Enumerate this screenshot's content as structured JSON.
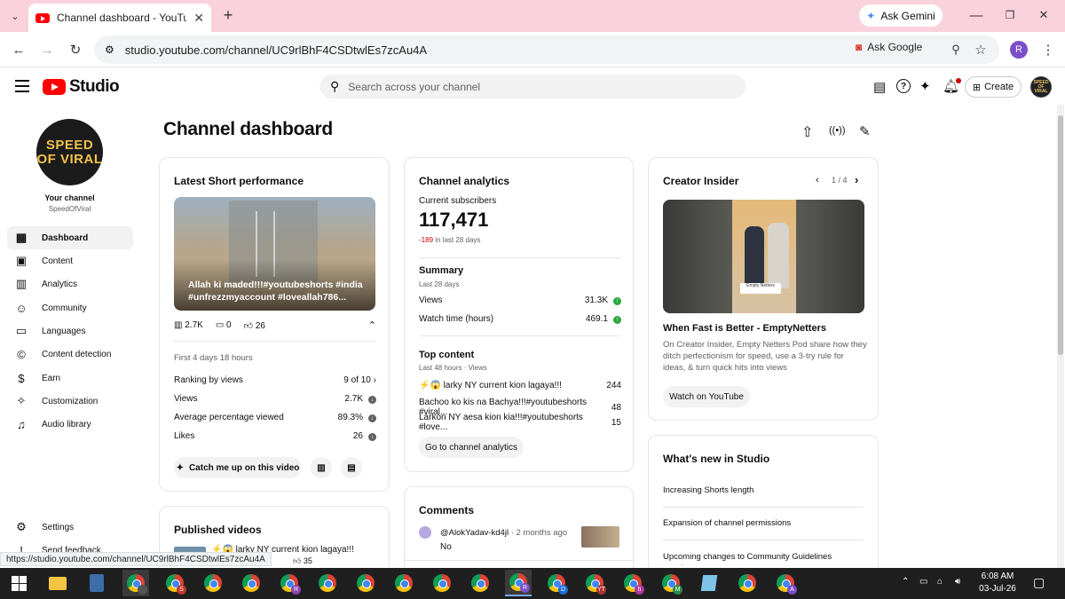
{
  "browser": {
    "tab_title": "Channel dashboard - YouTube Studio",
    "gemini_label": "Ask Gemini",
    "url": "studio.youtube.com/channel/UC9rlBhF4CSDtwlEs7zcAu4A",
    "ask_google_label": "Ask Google",
    "profile_initial": "R"
  },
  "header": {
    "brand": "Studio",
    "search_placeholder": "Search across your channel",
    "create_label": "Create"
  },
  "sidebar": {
    "your_channel": "Your channel",
    "channel_name": "SpeedOfViral",
    "logo_text": "SPEED OF VIRAL",
    "items": [
      {
        "label": "Dashboard",
        "icon": "grid-icon"
      },
      {
        "label": "Content",
        "icon": "content-icon"
      },
      {
        "label": "Analytics",
        "icon": "analytics-icon"
      },
      {
        "label": "Community",
        "icon": "community-icon"
      },
      {
        "label": "Languages",
        "icon": "languages-icon"
      },
      {
        "label": "Content detection",
        "icon": "copyright-icon"
      },
      {
        "label": "Earn",
        "icon": "dollar-icon"
      },
      {
        "label": "Customization",
        "icon": "wand-icon"
      },
      {
        "label": "Audio library",
        "icon": "audio-library-icon"
      }
    ],
    "settings": "Settings",
    "feedback": "Send feedback"
  },
  "main": {
    "title": "Channel dashboard",
    "latest_short": {
      "title": "Latest Short performance",
      "video_caption": "Allah ki maded!!!#youtubeshorts #india #unfrezzmyaccount #loveallah786...",
      "views_count": "2.7K",
      "comments_count": "0",
      "likes_count": "26",
      "period": "First 4 days 18 hours",
      "stats": [
        {
          "label": "Ranking by views",
          "value": "9 of 10"
        },
        {
          "label": "Views",
          "value": "2.7K"
        },
        {
          "label": "Average percentage viewed",
          "value": "89.3%"
        },
        {
          "label": "Likes",
          "value": "26"
        }
      ],
      "catch_up_label": "Catch me up on this video"
    },
    "analytics": {
      "title": "Channel analytics",
      "subs_label": "Current subscribers",
      "subs_value": "117,471",
      "subs_change": "-189",
      "subs_change_period": "in last 28 days",
      "summary_title": "Summary",
      "summary_period": "Last 28 days",
      "summary_rows": [
        {
          "label": "Views",
          "value": "31.3K"
        },
        {
          "label": "Watch time (hours)",
          "value": "469.1"
        }
      ],
      "top_title": "Top content",
      "top_period": "Last 48 hours · Views",
      "top_rows": [
        {
          "label": "⚡😱 larky NY current kion lagaya!!!",
          "value": "244"
        },
        {
          "label": "Bachoo ko kis na Bachya!!!#youtubeshorts #viral...",
          "value": "48"
        },
        {
          "label": "Larkon NY aesa kion kia!!!#youtubeshorts #love...",
          "value": "15"
        }
      ],
      "go_label": "Go to channel analytics"
    },
    "insider": {
      "title": "Creator Insider",
      "pager": "1 / 4",
      "video_badge": "Empty Netters",
      "video_title": "When Fast is Better - EmptyNetters",
      "video_desc": "On Creator Insider, Empty Netters Pod share how they ditch perfectionism for speed, use a 3-try rule for ideas, & turn quick hits into views",
      "watch_label": "Watch on YouTube"
    },
    "whats_new": {
      "title": "What's new in Studio",
      "items": [
        "Increasing Shorts length",
        "Expansion of channel permissions",
        "Upcoming changes to Community Guidelines warnings"
      ]
    },
    "published": {
      "title": "Published videos",
      "first_video": "⚡😱 larky NY current kion lagaya!!!",
      "first_likes": "35"
    },
    "comments": {
      "title": "Comments",
      "author": "@AlokYadav-kd4jl",
      "time": "· 2 months ago",
      "text": "No"
    }
  },
  "status_url": "https://studio.youtube.com/channel/UC9rlBhF4CSDtwlEs7zcAu4A",
  "taskbar": {
    "time": "6:08 AM",
    "date": "03-Jul-26",
    "badges": [
      "S",
      "",
      "",
      "R",
      "",
      "",
      "R",
      "D",
      "YT",
      "h",
      "M",
      "",
      "",
      "A"
    ]
  }
}
